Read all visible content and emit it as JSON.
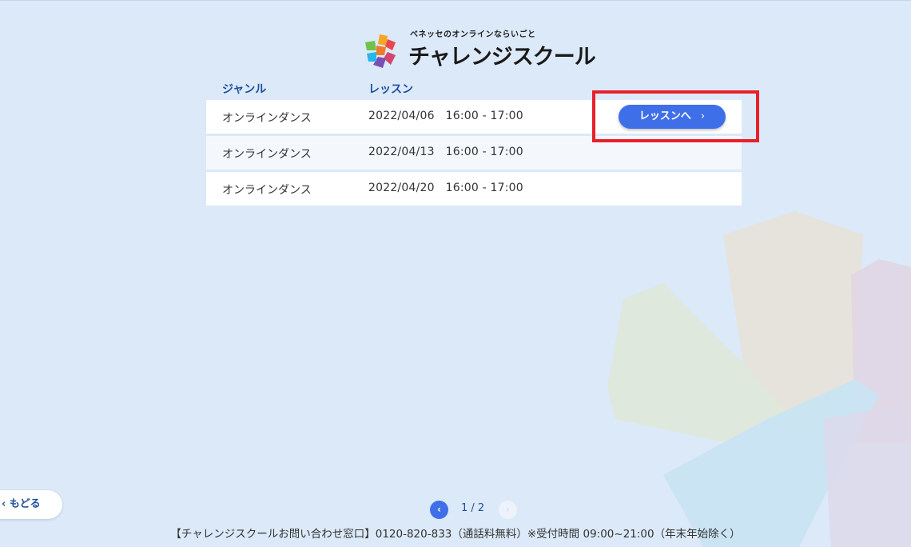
{
  "header": {
    "subtitle": "ベネッセのオンラインならいごと",
    "brand": "チャレンジスクール"
  },
  "table": {
    "headers": {
      "genre": "ジャンル",
      "lesson": "レッスン"
    },
    "rows": [
      {
        "genre": "オンラインダンス",
        "date": "2022/04/06   16:00 - 17:00",
        "button": "レッスンへ"
      },
      {
        "genre": "オンラインダンス",
        "date": "2022/04/13   16:00 - 17:00"
      },
      {
        "genre": "オンラインダンス",
        "date": "2022/04/20   16:00 - 17:00"
      }
    ]
  },
  "nav": {
    "back_label": "もどる"
  },
  "pager": {
    "text": "1 / 2"
  },
  "footer": {
    "text": "【チャレンジスクールお問い合わせ窓口】0120-820-833（通話料無料）※受付時間 09:00~21:00（年末年始除く）"
  },
  "colors": {
    "accent": "#3f6fe8",
    "heading": "#1e4e9c",
    "highlight": "#e8202a",
    "background": "#dbe9f8"
  },
  "icons": {
    "back": "chevron-left-icon",
    "prev": "chevron-left-icon",
    "next": "chevron-right-icon",
    "logo": "flower-logo-icon"
  }
}
